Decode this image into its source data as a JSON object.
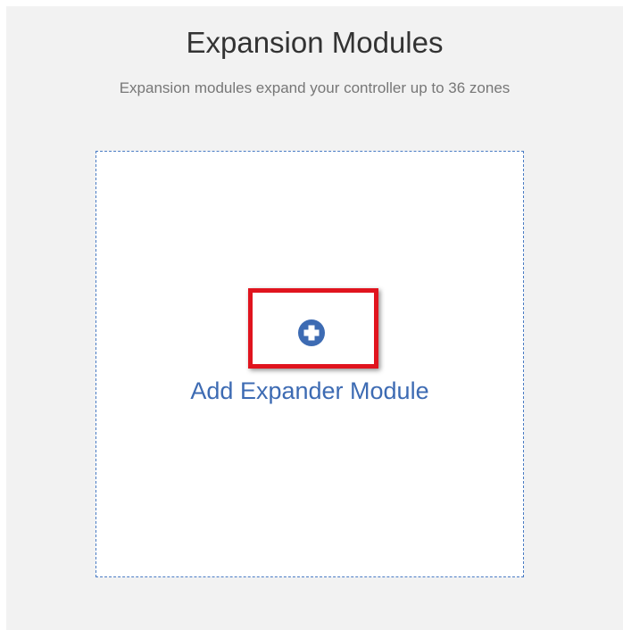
{
  "header": {
    "title": "Expansion Modules",
    "subtitle": "Expansion modules expand your controller up to 36 zones"
  },
  "dropzone": {
    "add_label": "Add Expander Module",
    "icon": "plus-circle-icon"
  },
  "colors": {
    "accent": "#3d6bb3",
    "highlight": "#e0141e",
    "panel_background": "#f2f2f2"
  }
}
